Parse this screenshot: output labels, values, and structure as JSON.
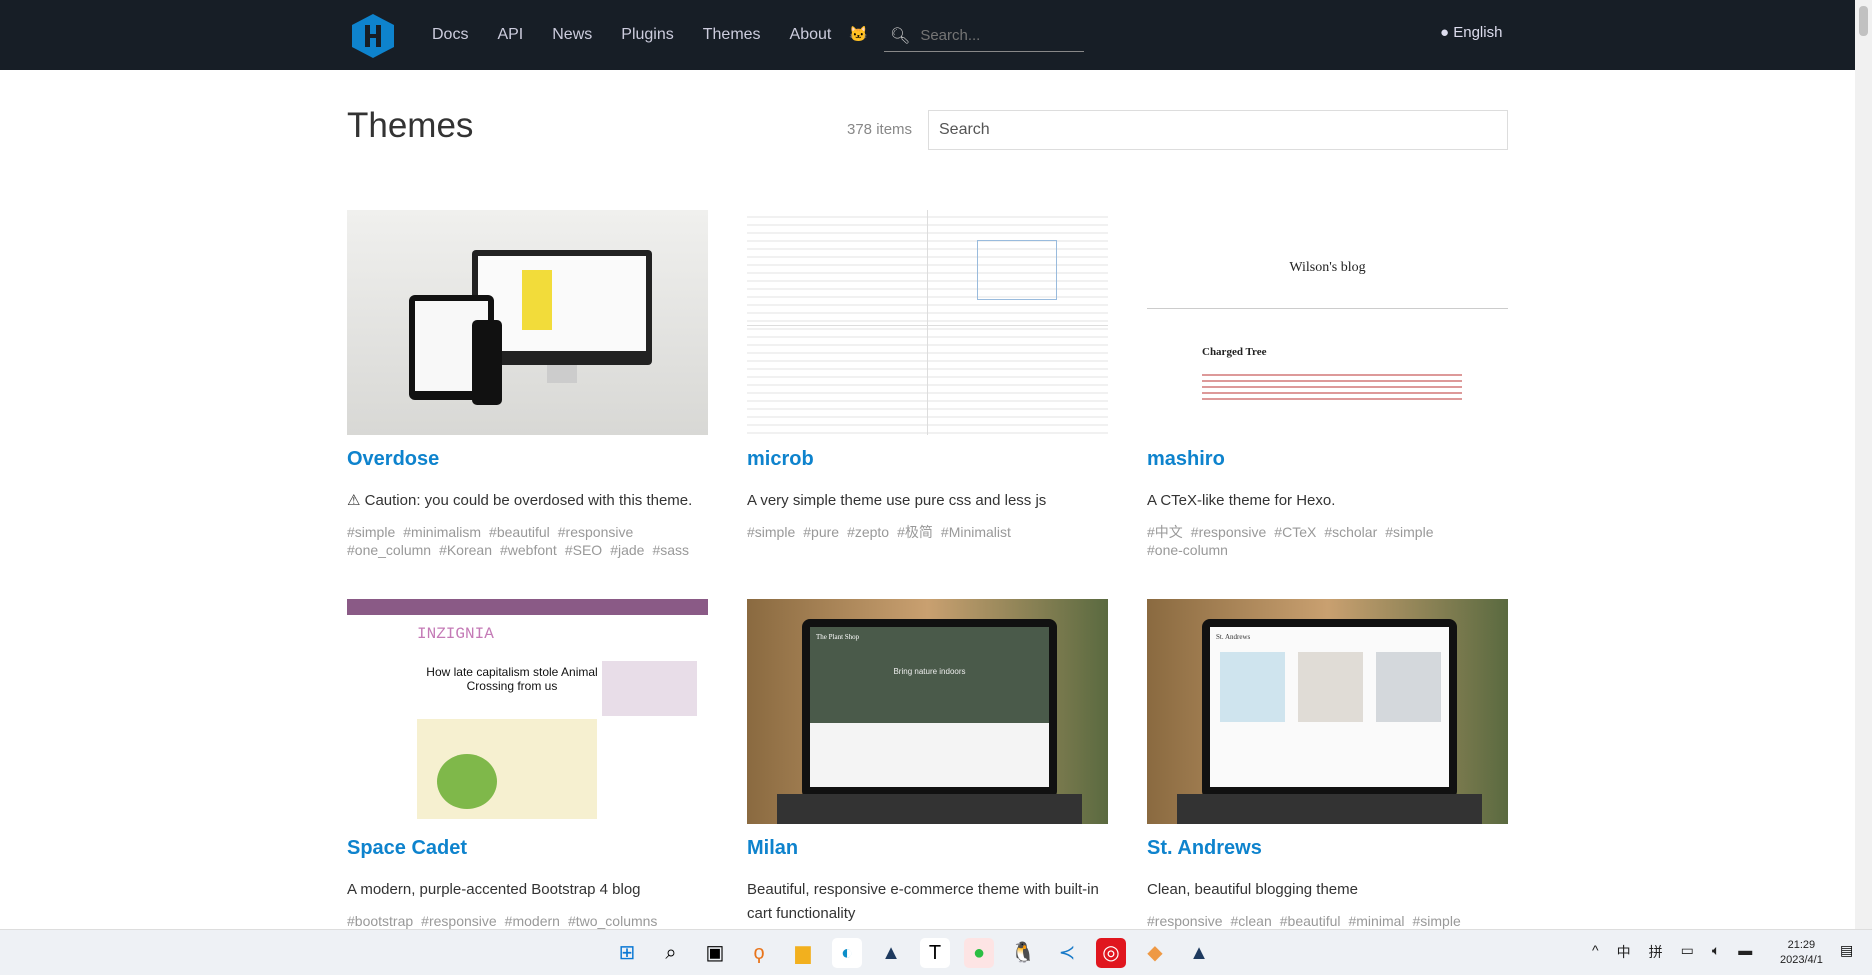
{
  "nav": {
    "links": [
      "Docs",
      "API",
      "News",
      "Plugins",
      "Themes",
      "About"
    ],
    "search_placeholder": "Search...",
    "language": "English",
    "brand_color": "#0e83cd"
  },
  "page": {
    "title": "Themes",
    "count": "378 items",
    "search_placeholder": "Search"
  },
  "themes": [
    {
      "name": "Overdose",
      "desc": "⚠ Caution: you could be overdosed with this theme.",
      "tags": [
        "#simple",
        "#minimalism",
        "#beautiful",
        "#responsive",
        "#one_column",
        "#Korean",
        "#webfont",
        "#SEO",
        "#jade",
        "#sass"
      ]
    },
    {
      "name": "microb",
      "desc": "A very simple theme use pure css and less js",
      "tags": [
        "#simple",
        "#pure",
        "#zepto",
        "#极简",
        "#Minimalist"
      ]
    },
    {
      "name": "mashiro",
      "desc": "A CTeX-like theme for Hexo.",
      "tags": [
        "#中文",
        "#responsive",
        "#CTeX",
        "#scholar",
        "#simple",
        "#one-column"
      ],
      "thumb_title": "Wilson's blog",
      "thumb_post": "Charged Tree"
    },
    {
      "name": "Space Cadet",
      "desc": "A modern, purple-accented Bootstrap 4 blog",
      "tags": [
        "#bootstrap",
        "#responsive",
        "#modern",
        "#two_columns"
      ],
      "thumb_title": "INZIGNIA",
      "thumb_post": "How late capitalism stole Animal Crossing from us"
    },
    {
      "name": "Milan",
      "desc": "Beautiful, responsive e-commerce theme with built-in cart functionality",
      "tags": [],
      "thumb_title": "The Plant Shop",
      "thumb_post": "Bring nature indoors"
    },
    {
      "name": "St. Andrews",
      "desc": "Clean, beautiful blogging theme",
      "tags": [
        "#responsive",
        "#clean",
        "#beautiful",
        "#minimal",
        "#simple"
      ],
      "thumb_title": "St. Andrews"
    }
  ],
  "taskbar": {
    "tray": [
      "^",
      "中",
      "拼"
    ],
    "time": "21:29",
    "date": "2023/4/1"
  }
}
